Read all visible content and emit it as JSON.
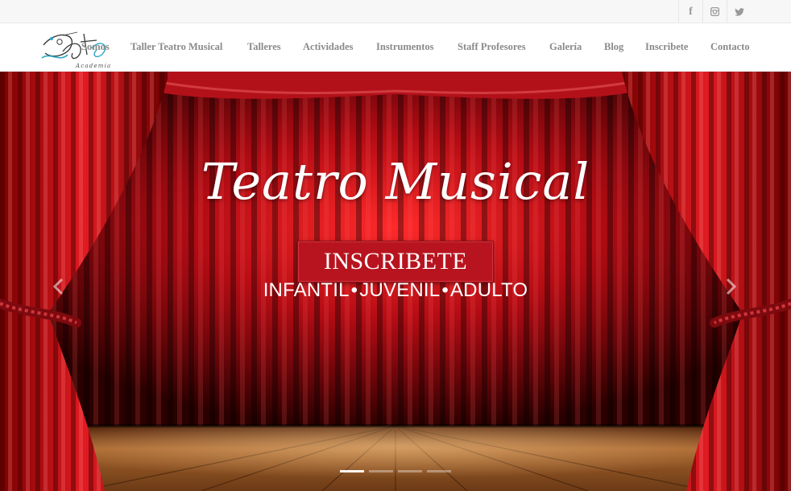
{
  "social": {
    "facebook": {
      "glyph": "f",
      "icon": "facebook-icon"
    },
    "instagram": {
      "glyph": "◘",
      "icon": "instagram-icon"
    },
    "twitter": {
      "glyph": "🐦",
      "icon": "twitter-icon"
    }
  },
  "logo": {
    "script_text": "Darts",
    "sub_text": "Academia"
  },
  "nav": {
    "items": [
      {
        "label": "Somos"
      },
      {
        "label": "Taller Teatro Musical"
      },
      {
        "label": "Talleres"
      },
      {
        "label": "Actividades"
      },
      {
        "label": "Instrumentos"
      },
      {
        "label": "Staff Profesores"
      },
      {
        "label": "Galería"
      },
      {
        "label": "Blog"
      },
      {
        "label": "Inscribete"
      },
      {
        "label": "Contacto"
      }
    ]
  },
  "hero": {
    "headline": "Teatro Musical",
    "cta_label": "INSCRIBETE",
    "levels": [
      "INFANTIL",
      "JUVENIL",
      "ADULTO"
    ],
    "separator": "•",
    "slide_count": 4,
    "active_slide": 1
  },
  "colors": {
    "curtain_red": "#c0121c",
    "button_red": "#b8141f",
    "nav_text": "#8a8a8a",
    "floor": "#b06a2c"
  }
}
